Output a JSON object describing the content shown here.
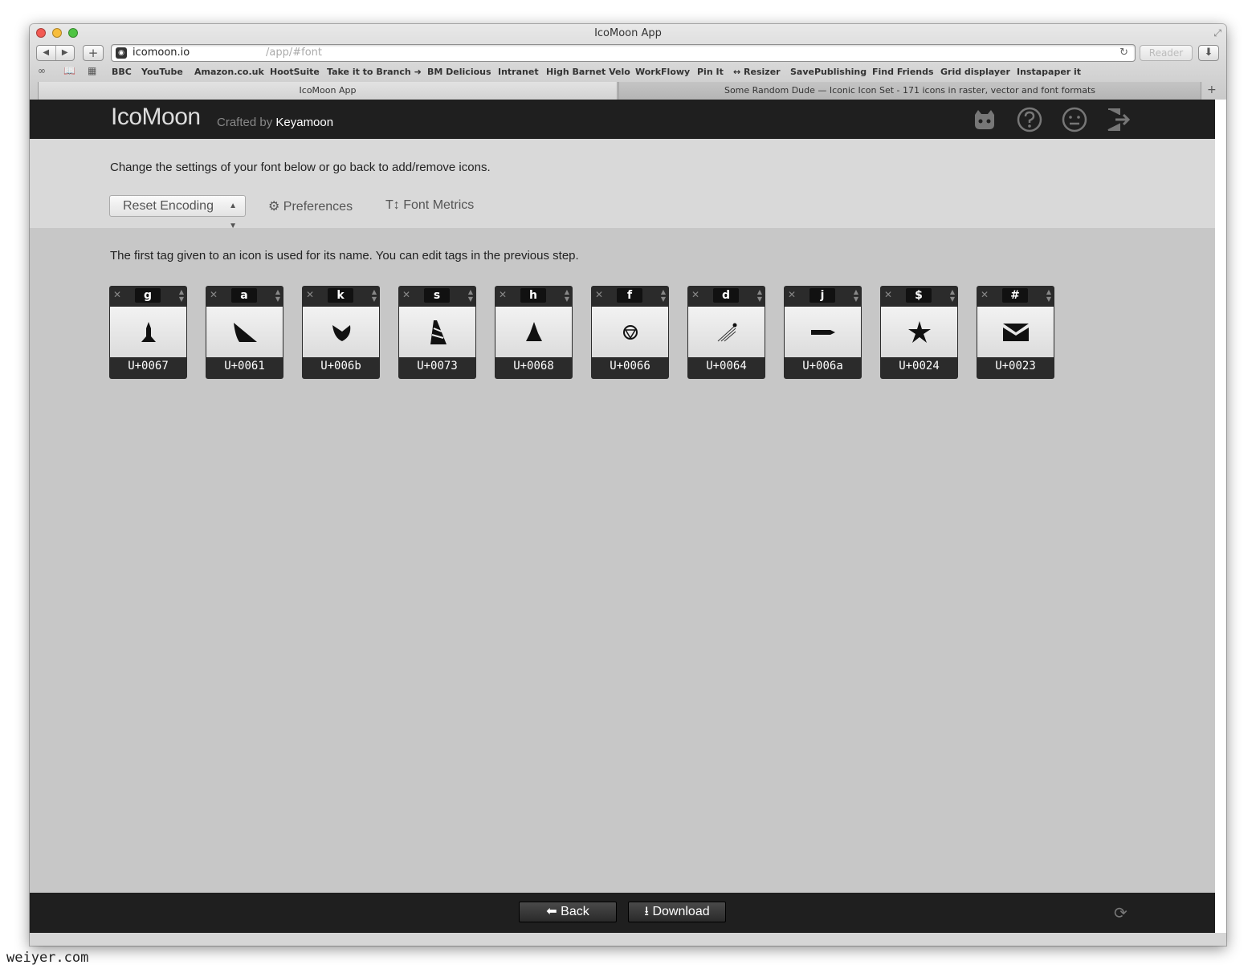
{
  "window": {
    "title": "IcoMoon App"
  },
  "toolbar": {
    "back_icon": "◀",
    "forward_icon": "▶",
    "add_icon": "+",
    "url_host": "icomoon.io",
    "url_path": "/app/#font",
    "reader_label": "Reader"
  },
  "bookmarks": [
    "BBC",
    "YouTube",
    "Amazon.co.uk",
    "HootSuite",
    "Take it to Branch ➜",
    "BM Delicious",
    "Intranet",
    "High Barnet Velo",
    "WorkFlowy",
    "Pin It",
    "↔ Resizer",
    "SavePublishing",
    "Find Friends",
    "Grid displayer",
    "Instapaper it"
  ],
  "tabs": [
    "IcoMoon App",
    "Some Random Dude — Iconic Icon Set - 171 icons in raster, vector and font formats"
  ],
  "header": {
    "logo": "IcoMoon",
    "crafted_by": "Crafted by",
    "author": "Keyamoon",
    "icons": [
      "github-icon",
      "help-icon",
      "smiley-icon",
      "logout-icon"
    ]
  },
  "settings": {
    "instruction": "Change the settings of your font below or go back to add/remove icons.",
    "encoding_select": "Reset Encoding",
    "preferences": "Preferences",
    "font_metrics": "Font Metrics"
  },
  "main": {
    "tag_note": "The first tag given to an icon is used for its name. You can edit tags in the previous step."
  },
  "glyphs": [
    {
      "char": "g",
      "code": "U+0067",
      "icon": "rocket-icon"
    },
    {
      "char": "a",
      "code": "U+0061",
      "icon": "solar-sail-icon"
    },
    {
      "char": "k",
      "code": "U+006b",
      "icon": "satellite-dish-icon"
    },
    {
      "char": "s",
      "code": "U+0073",
      "icon": "tower-icon"
    },
    {
      "char": "h",
      "code": "U+0068",
      "icon": "shuttle-icon"
    },
    {
      "char": "f",
      "code": "U+0066",
      "icon": "globe-icon"
    },
    {
      "char": "d",
      "code": "U+0064",
      "icon": "sputnik-icon"
    },
    {
      "char": "j",
      "code": "U+006a",
      "icon": "missile-icon"
    },
    {
      "char": "$",
      "code": "U+0024",
      "icon": "star-burst-icon"
    },
    {
      "char": "#",
      "code": "U+0023",
      "icon": "envelope-icon"
    }
  ],
  "footer": {
    "back": "Back",
    "download": "Download"
  },
  "watermark": "weiyer.com"
}
